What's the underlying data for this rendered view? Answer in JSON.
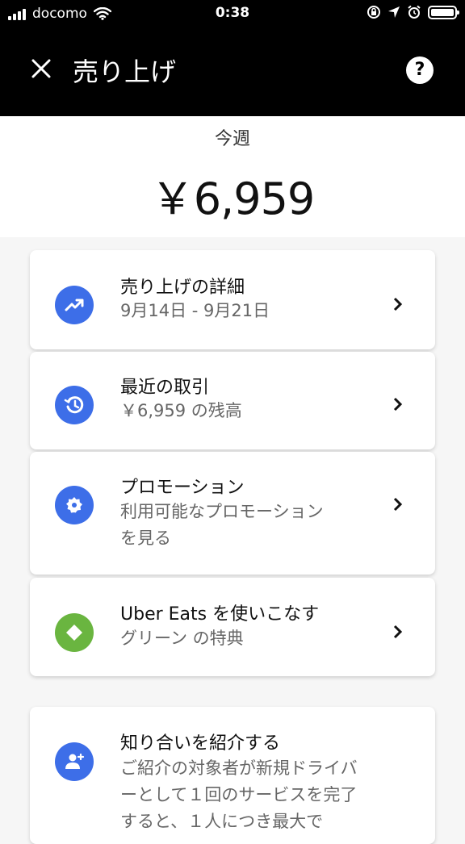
{
  "status_bar": {
    "carrier": "docomo",
    "time": "0:38"
  },
  "header": {
    "title": "売り上げ",
    "help_label": "?"
  },
  "summary": {
    "period": "今週",
    "amount": "￥6,959"
  },
  "cards": [
    {
      "title": "売り上げの詳細",
      "subtitle": "9月14日 - 9月21日",
      "icon": "trending-up-icon",
      "icon_color": "#3d6ee8"
    },
    {
      "title": "最近の取引",
      "subtitle": "￥6,959 の残高",
      "icon": "history-icon",
      "icon_color": "#3d6ee8"
    },
    {
      "title": "プロモーション",
      "subtitle_lines": [
        "利用可能なプロモーション",
        "を見る"
      ],
      "icon": "badge-icon",
      "icon_color": "#3d6ee8"
    },
    {
      "title": "Uber Eats を使いこなす",
      "subtitle": "グリーン の特典",
      "icon": "diamond-icon",
      "icon_color": "#6ab540"
    },
    {
      "title": "知り合いを紹介する",
      "subtitle_lines": [
        "ご紹介の対象者が新規ドライバ",
        "ーとして１回のサービスを完了",
        "すると、１人につき最大で"
      ],
      "icon": "add-person-icon",
      "icon_color": "#3d6ee8"
    }
  ]
}
